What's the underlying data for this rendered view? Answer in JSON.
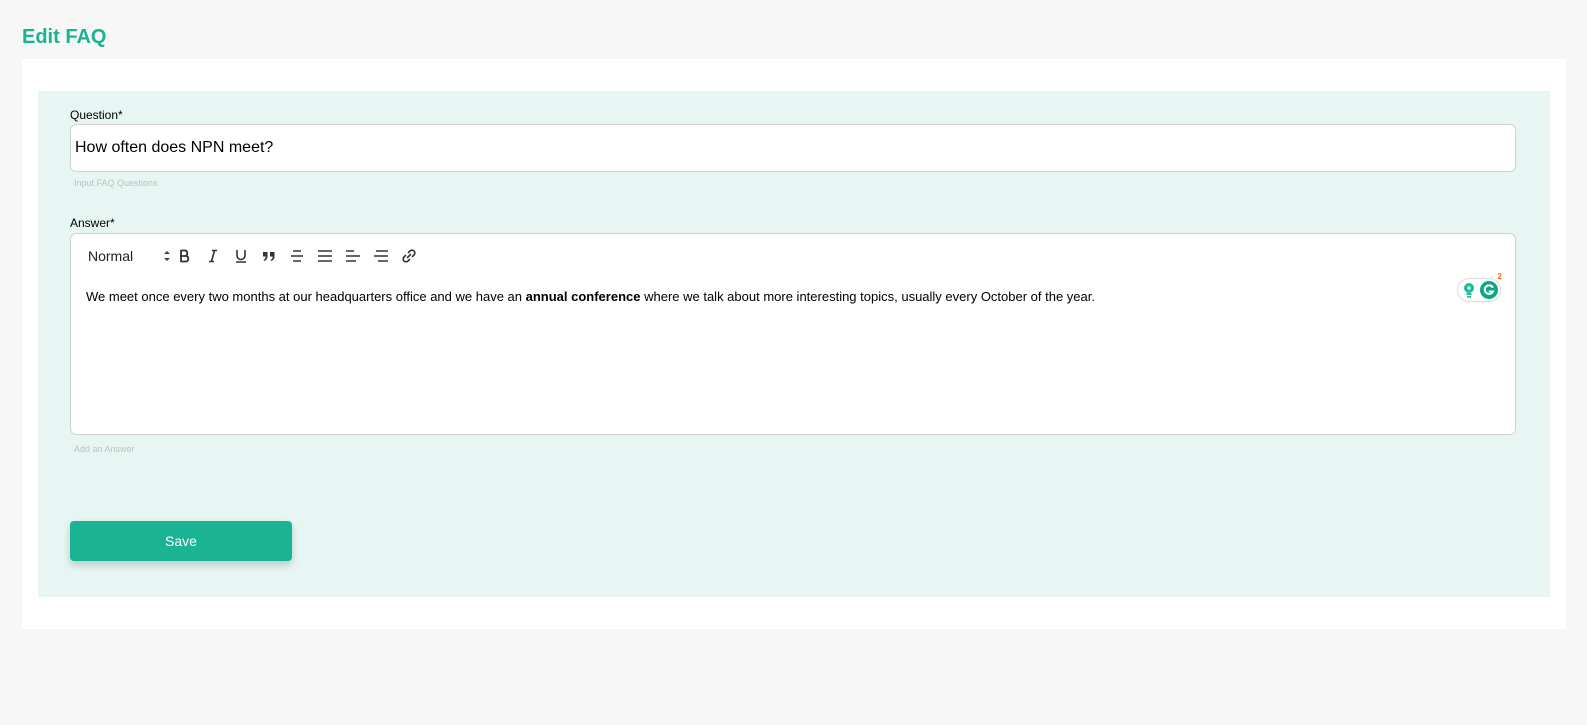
{
  "page": {
    "title": "Edit FAQ"
  },
  "colors": {
    "accent": "#1ab394",
    "panel_bg": "#e7f6f2",
    "page_bg": "#f7f7f7"
  },
  "form": {
    "question": {
      "label": "Question*",
      "value": "How often does NPN meet?",
      "helper": "Input FAQ Questions"
    },
    "answer": {
      "label": "Answer*",
      "helper": "Add an Answer",
      "format_select": "Normal",
      "toolbar_icons": [
        "bold-icon",
        "italic-icon",
        "underline-icon",
        "blockquote-icon",
        "strikethrough-icon",
        "align-center-icon",
        "align-left-icon",
        "align-right-icon",
        "link-icon"
      ],
      "content": {
        "before": "We meet once every two months at our headquarters office and we have an ",
        "bold": "annual conference",
        "after": " where we talk about more interesting topics, usually every October of the year."
      }
    },
    "grammarly": {
      "badge_count": "2"
    },
    "save_label": "Save"
  }
}
